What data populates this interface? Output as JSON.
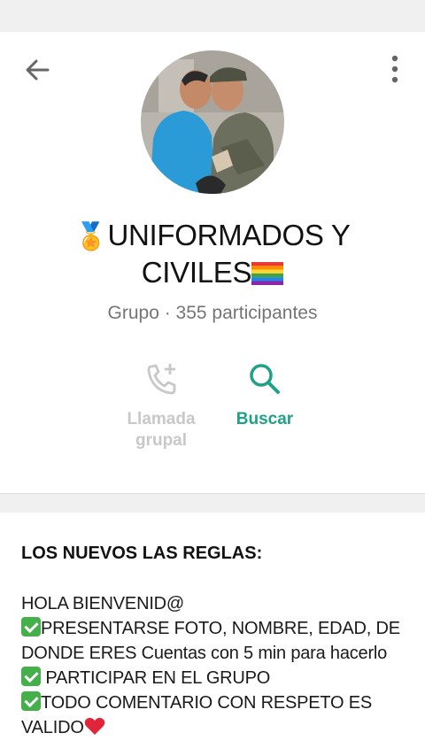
{
  "header": {
    "group_name_line1": "UNIFORMADOS Y",
    "group_name_line2": "CIVILES",
    "subtitle": "Grupo · 355 participantes"
  },
  "icons": {
    "back": "arrow-left-icon",
    "more": "more-vert-icon",
    "medal": "medal-emoji",
    "rainbow_flag": "rainbow-flag-emoji",
    "call": "add-call-icon",
    "search": "search-icon",
    "check": "check-mark-emoji",
    "heart": "red-heart-emoji"
  },
  "actions": {
    "call_label_line1": "Llamada",
    "call_label_line2": "grupal",
    "search_label": "Buscar"
  },
  "description": {
    "heading": "LOS NUEVOS LAS REGLAS:",
    "greeting": "HOLA BIENVENID@",
    "rule1": "PRESENTARSE FOTO, NOMBRE, EDAD, DE DONDE ERES Cuentas con 5 min para hacerlo",
    "rule2": " PARTICIPAR EN EL GRUPO",
    "rule3": "TODO COMENTARIO CON RESPETO ES VALIDO"
  },
  "colors": {
    "accent": "#1fa187",
    "disabled": "#c8c8c8",
    "subtitle": "#757575",
    "check": "#43b049"
  }
}
